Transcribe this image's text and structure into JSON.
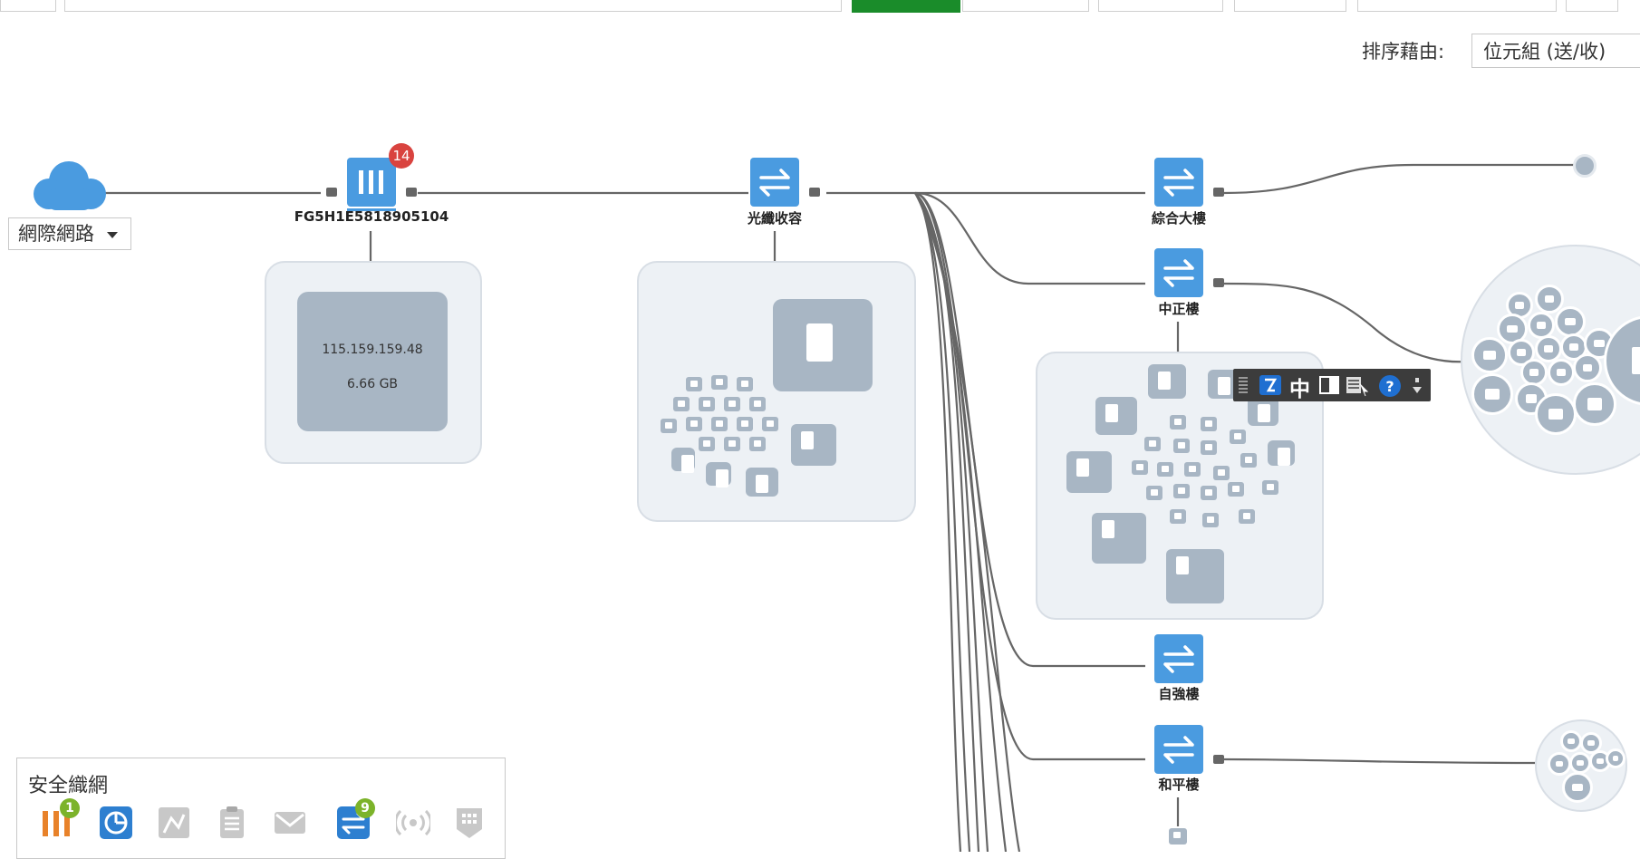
{
  "sort": {
    "label": "排序藉由:",
    "value": "位元組 (送/收)"
  },
  "internet": {
    "dropdown_label": "網際網路"
  },
  "firewall": {
    "name": "FG5H1E5818905104",
    "badge": "14",
    "ip": "115.159.159.48",
    "usage": "6.66 GB"
  },
  "switches": {
    "fiber": "光纖收容",
    "building1": "綜合大樓",
    "building2": "中正樓",
    "building3": "自強樓",
    "building4": "和平樓"
  },
  "ime": {
    "mode": "中"
  },
  "legend": {
    "title": "安全織網",
    "fortigate_badge": "1",
    "switch_badge": "9"
  },
  "colors": {
    "accent": "#4a9be0",
    "device": "#a8b6c4",
    "badge_red": "#d9433f",
    "badge_green": "#7cb32a",
    "fortigate_orange": "#e8822a",
    "tab_green": "#1a8c2a"
  }
}
